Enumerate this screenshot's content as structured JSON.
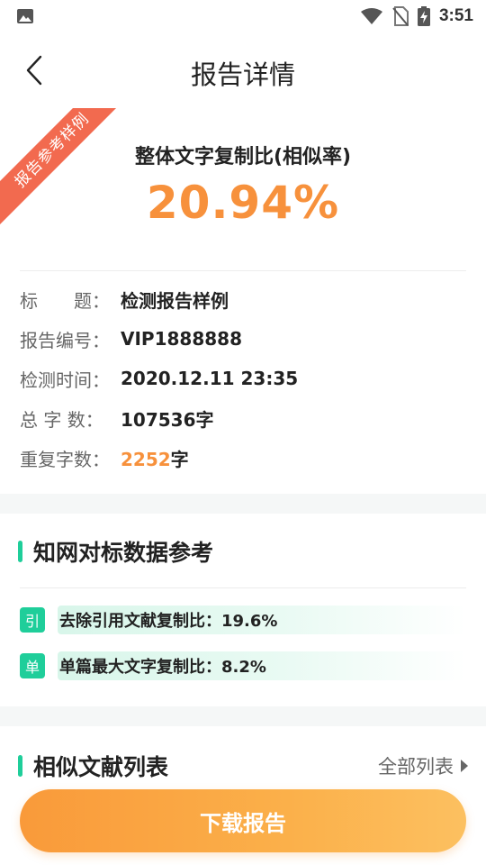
{
  "status_bar": {
    "time": "3:51",
    "icons": [
      "image-icon",
      "wifi-icon",
      "no-sim-icon",
      "battery-charging-icon"
    ]
  },
  "header": {
    "title": "报告详情",
    "back_icon": "chevron-left-icon"
  },
  "ribbon": {
    "label": "报告参考样例",
    "color": "#f26a4f"
  },
  "summary": {
    "title": "整体文字复制比(相似率)",
    "rate": "20.94%",
    "rate_color": "#f7913c"
  },
  "info": {
    "title_label": "标　　题：",
    "title_value": "检测报告样例",
    "number_label": "报告编号：",
    "number_value": "VIP1888888",
    "time_label": "检测时间：",
    "time_value": "2020.12.11 23:35",
    "total_label": "总 字 数：",
    "total_value": "107536字",
    "dup_label": "重复字数：",
    "dup_number": "2252",
    "dup_unit": "字"
  },
  "cnki": {
    "title": "知网对标数据参考",
    "accent_color": "#1fce9a",
    "metrics": [
      {
        "badge": "引",
        "text": "去除引用文献复制比：19.6%"
      },
      {
        "badge": "单",
        "text": "单篇最大文字复制比：8.2%"
      }
    ]
  },
  "similar": {
    "title": "相似文献列表",
    "link_label": "全部列表"
  },
  "footer": {
    "download_label": "下载报告",
    "button_color": "#f99a3a"
  }
}
